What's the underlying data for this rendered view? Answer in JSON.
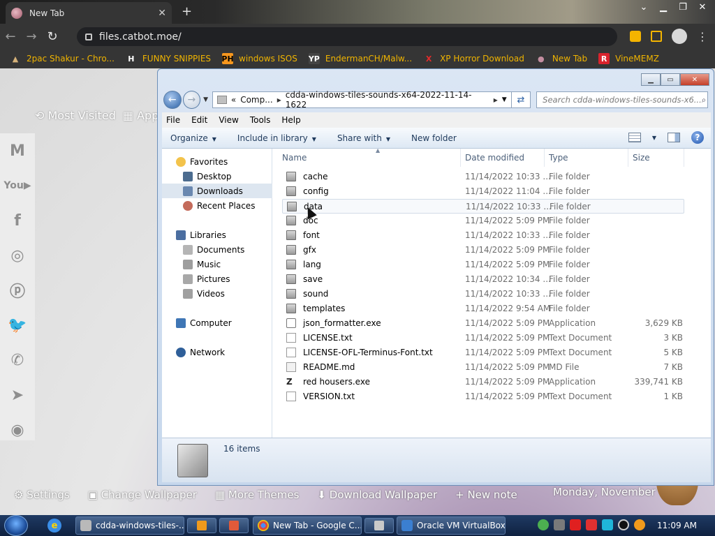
{
  "browser": {
    "tab_title": "New Tab",
    "url": "files.catbot.moe/",
    "bookmarks": [
      {
        "label": "2pac Shakur - Chro...",
        "icon": "PH-person",
        "icon_color": "#d6b27a"
      },
      {
        "label": "FUNNY SNIPPIES",
        "icon": "H",
        "icon_color": "#ffffff"
      },
      {
        "label": "windows ISOS",
        "icon": "PH",
        "icon_color": "#f7971e"
      },
      {
        "label": "EndermanCH/Malw...",
        "icon": "YP",
        "icon_color": "#444444"
      },
      {
        "label": "XP Horror Download",
        "icon": "X",
        "icon_color": "#e32b2b"
      },
      {
        "label": "New Tab",
        "icon": "chrome-ball",
        "icon_color": "#c48ea0"
      },
      {
        "label": "VineMEMZ",
        "icon": "R",
        "icon_color": "#d9232d"
      }
    ]
  },
  "ntp": {
    "most_visited": "Most Visited",
    "apps": "Apps",
    "social_icons": [
      "gmail-icon",
      "youtube-icon",
      "facebook-icon",
      "instagram-icon",
      "pinterest-icon",
      "twitter-icon",
      "whatsapp-icon",
      "telegram-icon",
      "reddit-icon"
    ],
    "bottom_links": [
      "Settings",
      "Change Wallpaper",
      "More Themes",
      "Download Wallpaper",
      "+ New note"
    ],
    "date_text": "Monday, November"
  },
  "explorer": {
    "breadcrumb": [
      "«",
      "Comp...",
      "cdda-windows-tiles-sounds-x64-2022-11-14-1622"
    ],
    "search_placeholder": "Search cdda-windows-tiles-sounds-x6...",
    "menu": [
      "File",
      "Edit",
      "View",
      "Tools",
      "Help"
    ],
    "commands": [
      "Organize",
      "Include in library",
      "Share with",
      "New folder"
    ],
    "nav": {
      "favorites": "Favorites",
      "favorites_items": [
        "Desktop",
        "Downloads",
        "Recent Places"
      ],
      "libraries": "Libraries",
      "libraries_items": [
        "Documents",
        "Music",
        "Pictures",
        "Videos"
      ],
      "computer": "Computer",
      "network": "Network",
      "selected": "Downloads"
    },
    "columns": [
      "Name",
      "Date modified",
      "Type",
      "Size"
    ],
    "files": [
      {
        "name": "cache",
        "date": "11/14/2022 10:33 ...",
        "type": "File folder",
        "size": "",
        "kind": "folder"
      },
      {
        "name": "config",
        "date": "11/14/2022 11:04 ...",
        "type": "File folder",
        "size": "",
        "kind": "folder"
      },
      {
        "name": "data",
        "date": "11/14/2022 10:33 ...",
        "type": "File folder",
        "size": "",
        "kind": "folder"
      },
      {
        "name": "doc",
        "date": "11/14/2022 5:09 PM",
        "type": "File folder",
        "size": "",
        "kind": "folder"
      },
      {
        "name": "font",
        "date": "11/14/2022 10:33 ...",
        "type": "File folder",
        "size": "",
        "kind": "folder"
      },
      {
        "name": "gfx",
        "date": "11/14/2022 5:09 PM",
        "type": "File folder",
        "size": "",
        "kind": "folder"
      },
      {
        "name": "lang",
        "date": "11/14/2022 5:09 PM",
        "type": "File folder",
        "size": "",
        "kind": "folder"
      },
      {
        "name": "save",
        "date": "11/14/2022 10:34 ...",
        "type": "File folder",
        "size": "",
        "kind": "folder"
      },
      {
        "name": "sound",
        "date": "11/14/2022 10:33 ...",
        "type": "File folder",
        "size": "",
        "kind": "folder"
      },
      {
        "name": "templates",
        "date": "11/14/2022 9:54 AM",
        "type": "File folder",
        "size": "",
        "kind": "folder"
      },
      {
        "name": "json_formatter.exe",
        "date": "11/14/2022 5:09 PM",
        "type": "Application",
        "size": "3,629 KB",
        "kind": "exe"
      },
      {
        "name": "LICENSE.txt",
        "date": "11/14/2022 5:09 PM",
        "type": "Text Document",
        "size": "3 KB",
        "kind": "txt"
      },
      {
        "name": "LICENSE-OFL-Terminus-Font.txt",
        "date": "11/14/2022 5:09 PM",
        "type": "Text Document",
        "size": "5 KB",
        "kind": "txt"
      },
      {
        "name": "README.md",
        "date": "11/14/2022 5:09 PM",
        "type": "MD File",
        "size": "7 KB",
        "kind": "md"
      },
      {
        "name": "red housers.exe",
        "date": "11/14/2022 5:09 PM",
        "type": "Application",
        "size": "339,741 KB",
        "kind": "exe2"
      },
      {
        "name": "VERSION.txt",
        "date": "11/14/2022 5:09 PM",
        "type": "Text Document",
        "size": "1 KB",
        "kind": "txt"
      }
    ],
    "hovered_file": "data",
    "item_count": "16 items"
  },
  "taskbar": {
    "tasks": [
      {
        "label": "cdda-windows-tiles-...",
        "icon_color": "#b9b9b9"
      },
      {
        "label": "New Tab - Google C...",
        "icon_color": "#e04a3a"
      },
      {
        "label": "Oracle VM VirtualBox...",
        "icon_color": "#3b7fd1"
      }
    ],
    "clock": "11:09 AM"
  }
}
